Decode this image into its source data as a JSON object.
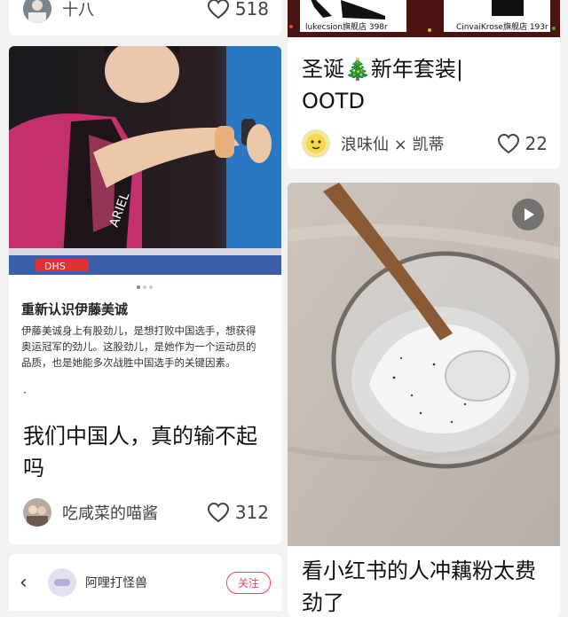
{
  "left_column": {
    "top_card": {
      "author": "十八",
      "likes": "518"
    },
    "article_card": {
      "image_banner_text": "ARIEL",
      "image_ad_text": "DHS",
      "article_title": "重新认识伊藤美诚",
      "article_body": "伊藤美诚身上有股劲儿，是想打败中国选手，想获得奥运冠军的劲儿。这股劲儿，是她作为一个运动员的品质，也是她能多次战胜中国选手的关键因素。",
      "article_mark": "·",
      "title": "我们中国人，真的输不起吗",
      "author": "吃咸菜的喵酱",
      "likes": "312"
    },
    "bottom_bar": {
      "author": "阿哩打怪兽",
      "follow_label": "关注"
    }
  },
  "right_column": {
    "top_card": {
      "shop_left": "lukecsion旗舰店 398r",
      "shop_right": "CinvaiKrose旗舰店 193r",
      "title": "圣诞🎄新年套装|\nOOTD",
      "author": "浪味仙 × 凯蒂",
      "likes": "22"
    },
    "video_card": {
      "title": "看小红书的人冲藕粉太费劲了"
    }
  },
  "colors": {
    "accent": "#ff3b5c",
    "background": "#f2f2f2",
    "card": "#ffffff"
  }
}
